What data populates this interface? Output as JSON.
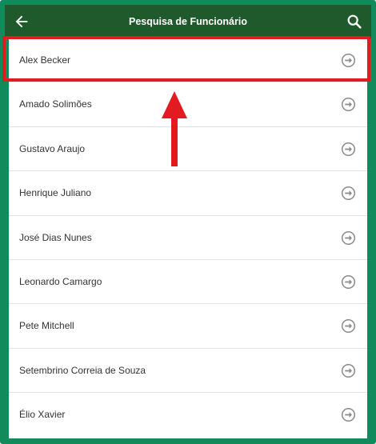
{
  "header": {
    "title": "Pesquisa de Funcionário",
    "back_icon": "arrow-left-icon",
    "search_icon": "search-icon"
  },
  "employees": [
    {
      "name": "Alex Becker"
    },
    {
      "name": "Amado Solimões"
    },
    {
      "name": "Gustavo Araujo"
    },
    {
      "name": "Henrique Juliano"
    },
    {
      "name": "José Dias Nunes"
    },
    {
      "name": "Leonardo Camargo"
    },
    {
      "name": "Pete Mitchell"
    },
    {
      "name": "Setembrino Correia de Souza"
    },
    {
      "name": "Élio Xavier"
    }
  ],
  "colors": {
    "frame": "#138a5b",
    "header": "#1f5a2c",
    "highlight": "#e21b22",
    "text": "#333333",
    "arrow_icon": "#8a8a8a"
  }
}
